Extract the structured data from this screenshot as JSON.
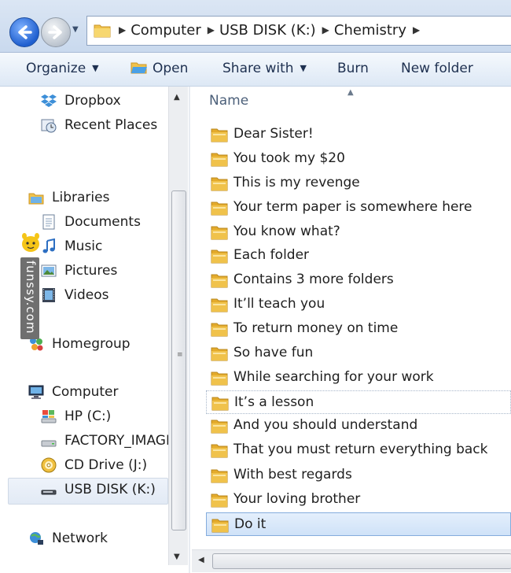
{
  "address": {
    "crumbs": [
      "Computer",
      "USB DISK (K:)",
      "Chemistry"
    ]
  },
  "toolbar": {
    "organize": "Organize",
    "open": "Open",
    "share_with": "Share with",
    "burn": "Burn",
    "new_folder": "New folder"
  },
  "nav": {
    "dropbox": "Dropbox",
    "recent_places": "Recent Places",
    "libraries": "Libraries",
    "documents": "Documents",
    "music": "Music",
    "pictures": "Pictures",
    "videos": "Videos",
    "homegroup": "Homegroup",
    "computer": "Computer",
    "hp_c": "HP (C:)",
    "factory_image": "FACTORY_IMAGI",
    "cd_drive": "CD Drive (J:)",
    "usb_disk": "USB DISK (K:)",
    "network": "Network"
  },
  "watermark": "funssy.com",
  "list": {
    "column_name": "Name",
    "items": [
      "Dear Sister!",
      "You took my $20",
      "This is my revenge",
      "Your term paper is somewhere here",
      "You know what?",
      "Each folder",
      "Contains 3 more folders",
      "It’ll teach you",
      "To return money on time",
      "So have fun",
      "While searching for your work",
      "It’s a lesson",
      "And you should understand",
      "That you must return everything back",
      "With best regards",
      "Your loving brother",
      "Do it"
    ]
  },
  "colors": {
    "selection": "#cfe2f8",
    "folder": "#f0c24b"
  }
}
